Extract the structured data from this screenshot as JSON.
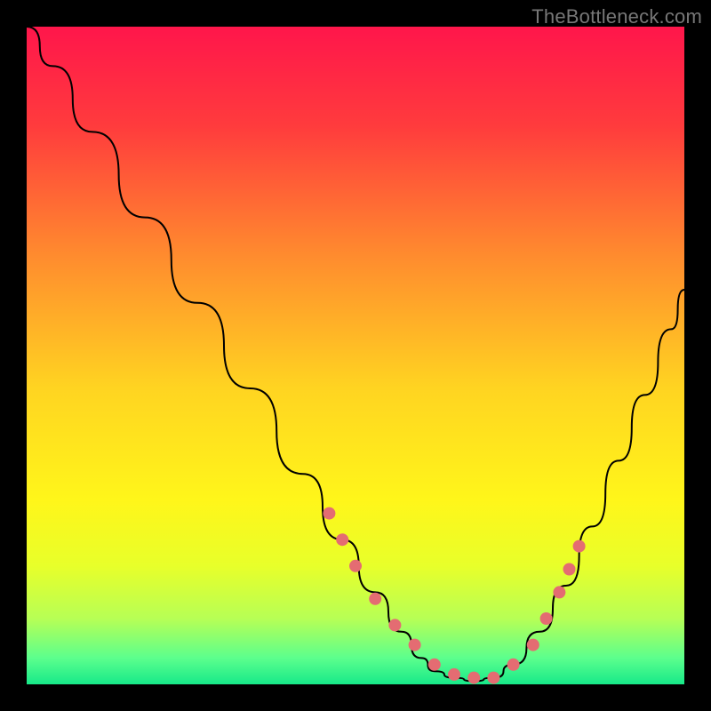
{
  "watermark": "TheBottleneck.com",
  "palette": {
    "gradient_stops": [
      {
        "offset": 0.0,
        "color": "#ff164b"
      },
      {
        "offset": 0.15,
        "color": "#ff3b3d"
      },
      {
        "offset": 0.35,
        "color": "#ff8c2e"
      },
      {
        "offset": 0.55,
        "color": "#ffd421"
      },
      {
        "offset": 0.72,
        "color": "#fff61a"
      },
      {
        "offset": 0.82,
        "color": "#e8ff2a"
      },
      {
        "offset": 0.9,
        "color": "#b7ff55"
      },
      {
        "offset": 0.96,
        "color": "#5cff8d"
      },
      {
        "offset": 1.0,
        "color": "#17e989"
      }
    ],
    "dot_color": "#e46c72",
    "curve_color": "#000000"
  },
  "chart_data": {
    "type": "line",
    "title": "",
    "xlabel": "",
    "ylabel": "",
    "xlim": [
      0,
      100
    ],
    "ylim": [
      0,
      100
    ],
    "grid": false,
    "legend": false,
    "series": [
      {
        "name": "curve",
        "x": [
          0,
          4,
          10,
          18,
          26,
          34,
          42,
          48,
          53,
          57,
          60,
          62,
          65,
          68,
          71,
          74,
          78,
          82,
          86,
          90,
          94,
          98,
          100
        ],
        "y": [
          100,
          94,
          84,
          71,
          58,
          45,
          32,
          22,
          14,
          8,
          4,
          2,
          1,
          0.5,
          1,
          3,
          8,
          15,
          24,
          34,
          44,
          54,
          60
        ]
      }
    ],
    "markers": {
      "name": "highlight-dots",
      "x": [
        46,
        48,
        50,
        53,
        56,
        59,
        62,
        65,
        68,
        71,
        74,
        77,
        79,
        81,
        82.5,
        84
      ],
      "y": [
        26,
        22,
        18,
        13,
        9,
        6,
        3,
        1.5,
        1,
        1,
        3,
        6,
        10,
        14,
        17.5,
        21
      ]
    }
  }
}
